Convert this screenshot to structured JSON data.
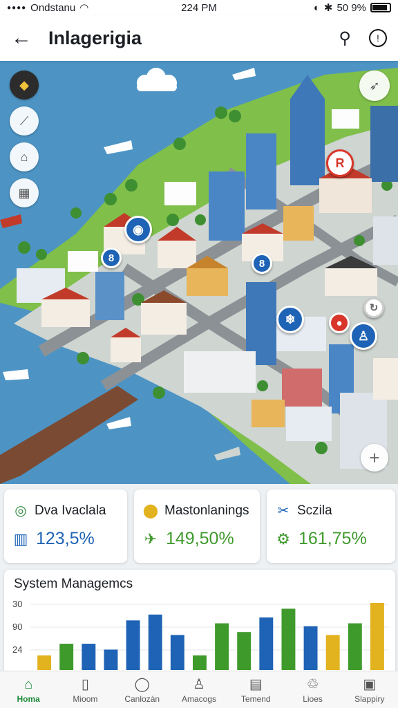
{
  "status": {
    "carrier": "Ondstanu",
    "time": "224 PM",
    "battery": "50 9%"
  },
  "header": {
    "title": "Inlagerigia"
  },
  "map": {
    "pins": [
      "8",
      "8",
      "R"
    ]
  },
  "stats": [
    {
      "label": "Dva Ivaclala",
      "value": "123,5%",
      "icon": "location-icon",
      "color": "#2f8a3c",
      "value_color": "#1e63b5"
    },
    {
      "label": "Mastonlanings",
      "value": "149,50%",
      "icon": "pin-icon",
      "color": "#e2b21f",
      "value_color": "#3f9a2c"
    },
    {
      "label": "Sczila",
      "value": "161,75%",
      "icon": "tool-icon",
      "color": "#1e63b5",
      "value_color": "#3f9a2c"
    }
  ],
  "chart_data": {
    "type": "bar",
    "title": "System Managemcs",
    "yticks": [
      "30",
      "90",
      "24"
    ],
    "values": [
      5,
      9,
      9,
      7,
      17,
      19,
      12,
      5,
      16,
      13,
      18,
      21,
      15,
      12,
      16,
      23
    ],
    "colors": [
      "#e2b21f",
      "#3f9a2c",
      "#1e63b5",
      "#1e63b5",
      "#1e63b5",
      "#1e63b5",
      "#1e63b5",
      "#3f9a2c",
      "#3f9a2c",
      "#3f9a2c",
      "#1e63b5",
      "#3f9a2c",
      "#1e63b5",
      "#e2b21f",
      "#3f9a2c",
      "#e2b21f"
    ]
  },
  "nav": [
    {
      "label": "Homa",
      "icon": "home-icon",
      "active": true
    },
    {
      "label": "Mioom",
      "icon": "book-icon",
      "active": false
    },
    {
      "label": "Canlozán",
      "icon": "circle-icon",
      "active": false
    },
    {
      "label": "Amacogs",
      "icon": "person-icon",
      "active": false
    },
    {
      "label": "Temend",
      "icon": "document-icon",
      "active": false
    },
    {
      "label": "Lioes",
      "icon": "recycle-icon",
      "active": false
    },
    {
      "label": "Slappiry",
      "icon": "map-icon",
      "active": false
    }
  ]
}
